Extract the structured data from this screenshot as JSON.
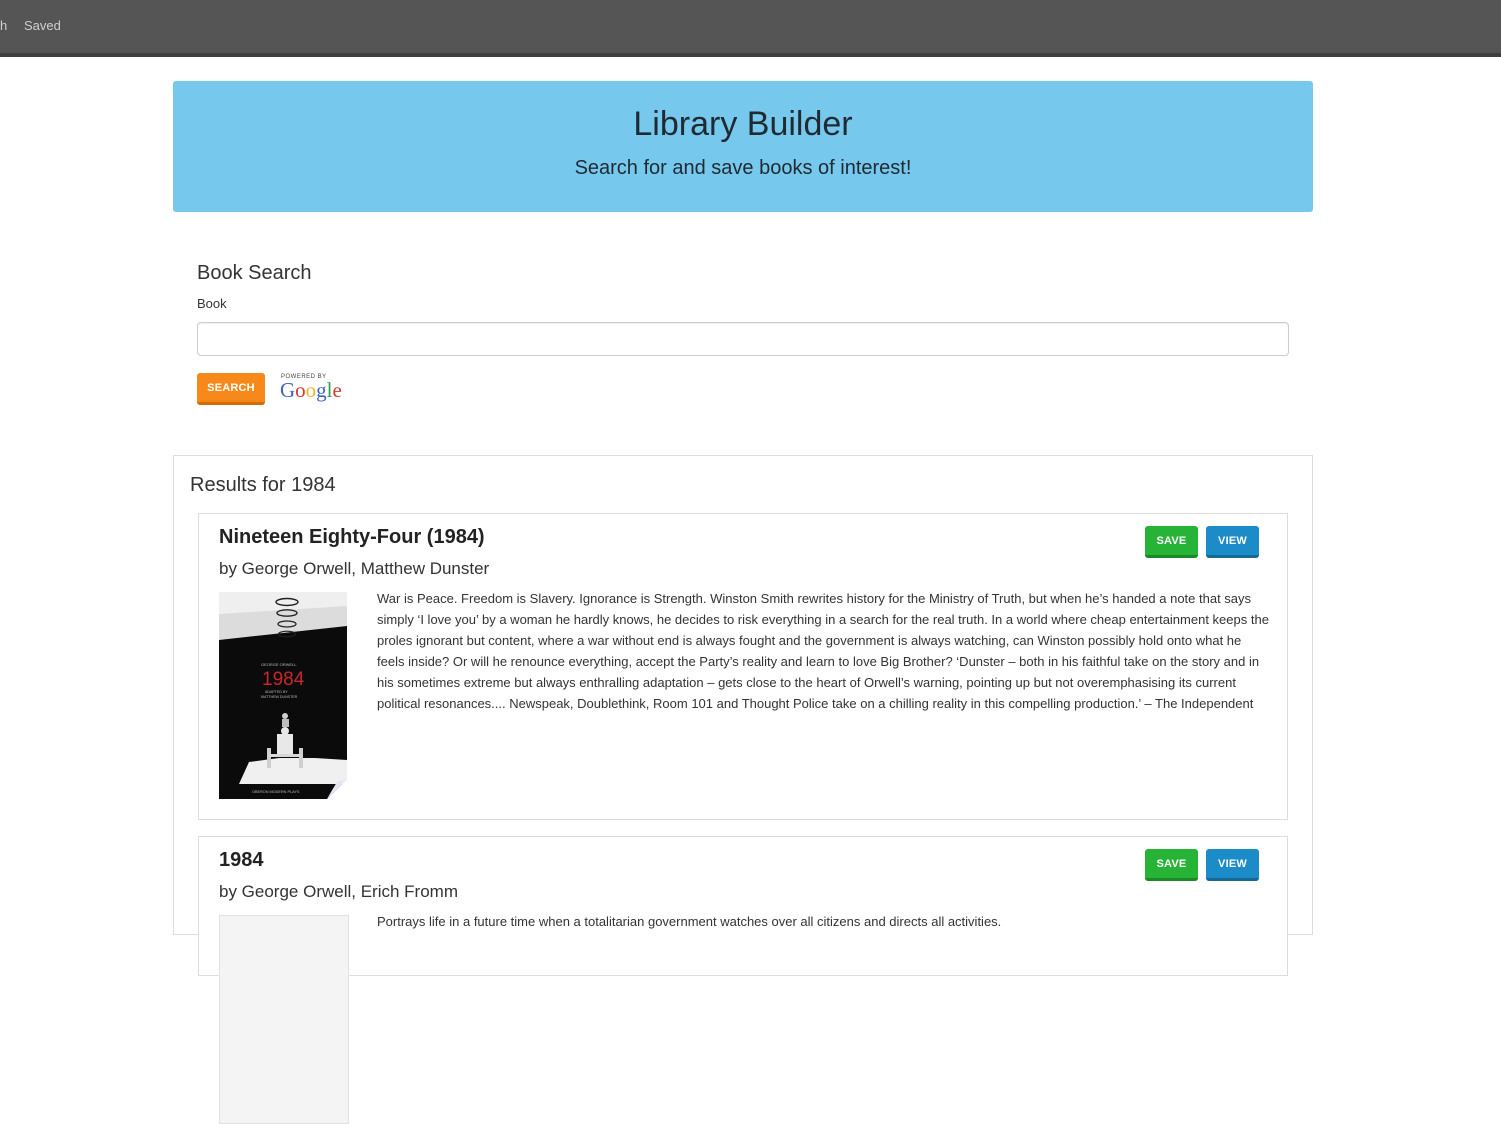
{
  "nav": {
    "search_label": "h",
    "saved_label": "Saved"
  },
  "header": {
    "title": "Library Builder",
    "subtitle": "Search for and save books of interest!"
  },
  "search": {
    "title": "Book Search",
    "field_label": "Book",
    "value": "",
    "button_label": "Search",
    "powered_by": "POWERED BY",
    "google": "Google"
  },
  "results": {
    "title": "Results for 1984",
    "books": [
      {
        "title": "Nineteen Eighty-Four (1984)",
        "authors": "by George Orwell, Matthew Dunster",
        "save_label": "Save",
        "view_label": "View",
        "description": "War is Peace. Freedom is Slavery. Ignorance is Strength. Winston Smith rewrites history for the Ministry of Truth, but when he’s handed a note that says simply ‘I love you’ by a woman he hardly knows, he decides to risk everything in a search for the real truth. In a world where cheap entertainment keeps the proles ignorant but content, where a war without end is always fought and the government is always watching, can Winston possibly hold onto what he feels inside? Or will he renounce everything, accept the Party’s reality and learn to love Big Brother? ‘Dunster – both in his faithful take on the story and in his sometimes extreme but always enthralling adaptation – gets close to the heart of Orwell’s warning, pointing up but not overemphasising its current political resonances.... Newspeak, Doublethink, Room 101 and Thought Police take on a chilling reality in this compelling production.’ – The Independent",
        "cover": {
          "author": "GEORGE ORWELL",
          "title": "1984",
          "adapted": "ADAPTED BY",
          "adapter": "MATTHEW DUNSTER",
          "publisher": "OBERON MODERN PLAYS"
        }
      },
      {
        "title": "1984",
        "authors": "by George Orwell, Erich Fromm",
        "save_label": "Save",
        "view_label": "View",
        "description": "Portrays life in a future time when a totalitarian government watches over all citizens and directs all activities."
      }
    ]
  },
  "colors": {
    "nav_bg": "#555555",
    "jumbotron": "#76c8ec",
    "search_button": "#f7891b",
    "save_button": "#27b336",
    "view_button": "#1b8cc7"
  }
}
